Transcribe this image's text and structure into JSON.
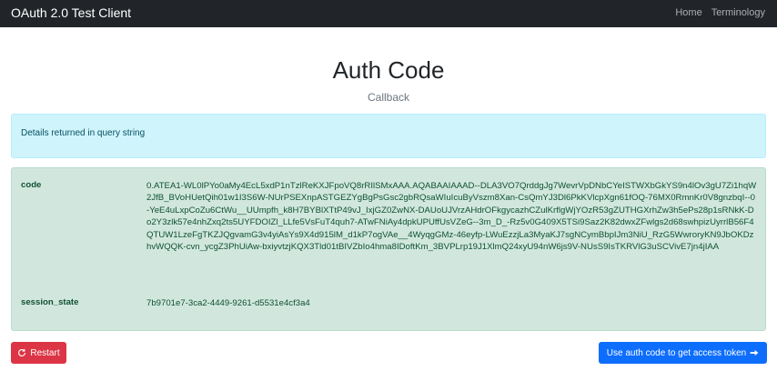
{
  "navbar": {
    "brand": "OAuth 2.0 Test Client",
    "links": [
      "Home",
      "Terminology"
    ]
  },
  "header": {
    "title": "Auth Code",
    "subtitle": "Callback"
  },
  "info_alert": {
    "text": "Details returned in query string"
  },
  "query_params": [
    {
      "key": "code",
      "value": "0.ATEA1-WL0lPYo0aMy4EcL5xdP1nTzlReKXJFpoVQ8rRIlSMxAAA.AQABAAIAAAD--DLA3VO7QrddgJg7WevrVpDNbCYeISTWXbGkYS9n4lOv3gU7Zi1hqW2JfB_BVoHUetQih01w1I3S6W-NUrPSEXnpASTGEZYgBgPsGsc2gbRQsaWIuIcuByVszm8Xan-CsQmYJ3Dl6PkKVlcpXgn61fOQ-76MX0RmnKr0V8gnzbqI--0-YeE4uLxpCoZu6CtWu__UUmpfh_k8H7BYBlXTtP49vJ_IxjGZ0ZwNX-DAUoUJVrzAHdrOFkgycazhCZulKrflgWjYOzR53gZUTHGXrhZw3h5ePs28p1sRNkK-Do2Y3zlk57e4nhZxq2ts5UYFDOIZl_LLfe5VsFuT4quh7-ATwFNiAy4dpkUPUffUsVZeG--3m_D_-Rz5v0G409X5TSi9Saz2K82dwxZFwlgs2d68swhpizUyrrlB56F4QTUW1LzeFgTKZJQgvamG3v4yiAsYs9X4d915lM_d1kP7ogVAe__4WyqgGMz-46eyfp-LWuEzzjLa3MyaKJ7sgNCymBbpIJm3NiU_RzG5WwroryKN9JbOKDzhvWQQK-cvn_ycgZ3PhUiAw-bxiyvtzjKQX3Tld01tBIVZbIo4hma8IDoftKm_3BVPLrp19J1XlmQ24xyU94nW6js9V-NUsS9IsTKRVlG3uSCVivE7jn4jIAA"
    },
    {
      "key": "session_state",
      "value": "7b9701e7-3ca2-4449-9261-d5531e4cf3a4"
    }
  ],
  "buttons": {
    "restart": "Restart",
    "get_token": "Use auth code to get access token"
  },
  "icons": {
    "restart": "refresh-icon",
    "get_token": "arrow-right-icon"
  },
  "colors": {
    "navbar": "#212529",
    "info_bg": "#cff4fc",
    "success_bg": "#d1e7dd",
    "danger": "#dc3545",
    "primary": "#0d6efd"
  }
}
